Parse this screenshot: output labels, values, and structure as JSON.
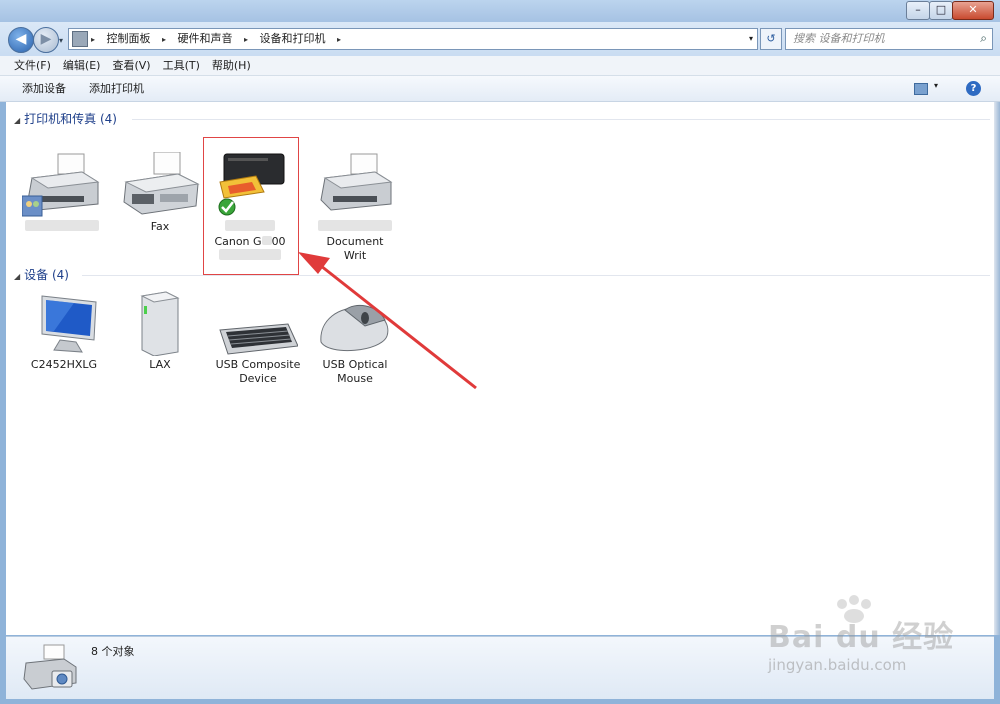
{
  "window": {
    "min_label": "–",
    "max_label": "□",
    "close_label": "✕"
  },
  "nav": {
    "back_glyph": "◀",
    "forward_glyph": "▶",
    "drop_glyph": "▾",
    "refresh_glyph": "↺",
    "breadcrumb": [
      "控制面板",
      "硬件和声音",
      "设备和打印机"
    ],
    "sep_glyph": "▸",
    "search_placeholder": "搜索 设备和打印机",
    "search_glyph": "⌕"
  },
  "menu": [
    "文件(F)",
    "编辑(E)",
    "查看(V)",
    "工具(T)",
    "帮助(H)"
  ],
  "commands": {
    "add_device": "添加设备",
    "add_printer": "添加打印机",
    "help_glyph": "?",
    "view_drop": "▾"
  },
  "groups": {
    "printers": {
      "title": "打印机和传真 (4)",
      "tri": "◢"
    },
    "devices": {
      "title": "设备 (4)",
      "tri": "◢"
    }
  },
  "printers": [
    {
      "label": ""
    },
    {
      "label": "Fax"
    },
    {
      "label": "Canon G",
      "label2": "00",
      "check": "✔"
    },
    {
      "label": "Document",
      "label2": "Writ"
    }
  ],
  "devices": [
    {
      "label": "C2452HXLG"
    },
    {
      "label": "LAX"
    },
    {
      "label": "USB Composite",
      "label2": "Device"
    },
    {
      "label": "USB Optical",
      "label2": "Mouse"
    }
  ],
  "status": {
    "text": "8 个对象"
  },
  "watermark": {
    "brand": "Bai du 经验",
    "url": "jingyan.baidu.com"
  },
  "colors": {
    "selection": "#e04545",
    "arrow": "#e03a3a",
    "group_title": "#1e3f8a"
  }
}
